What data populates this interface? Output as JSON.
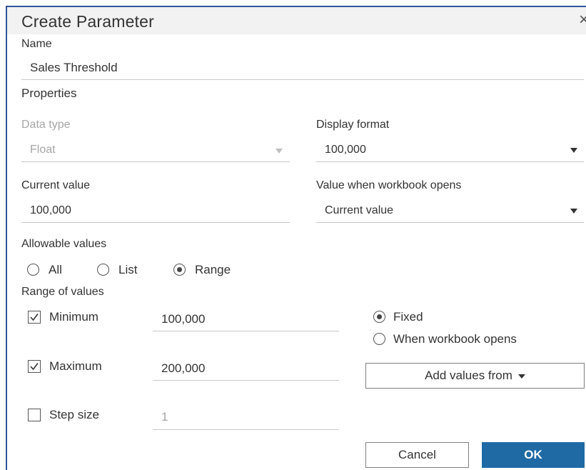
{
  "dialog": {
    "title": "Create Parameter",
    "close_symbol": "×"
  },
  "name": {
    "label": "Name",
    "value": "Sales Threshold"
  },
  "properties": {
    "label": "Properties",
    "data_type": {
      "label": "Data type",
      "value": "Float"
    },
    "display_format": {
      "label": "Display format",
      "value": "100,000"
    },
    "current_value": {
      "label": "Current value",
      "value": "100,000"
    },
    "value_when_opens": {
      "label": "Value when workbook opens",
      "value": "Current value"
    }
  },
  "allowable_values": {
    "label": "Allowable values",
    "options": [
      {
        "label": "All",
        "selected": false
      },
      {
        "label": "List",
        "selected": false
      },
      {
        "label": "Range",
        "selected": true
      }
    ]
  },
  "range": {
    "label": "Range of values",
    "minimum": {
      "label": "Minimum",
      "checked": true,
      "value": "100,000"
    },
    "maximum": {
      "label": "Maximum",
      "checked": true,
      "value": "200,000"
    },
    "step_size": {
      "label": "Step size",
      "checked": false,
      "value": "1"
    },
    "fixed_label": "Fixed",
    "when_opens_label": "When workbook opens",
    "add_values_from": "Add values from"
  },
  "buttons": {
    "cancel": "Cancel",
    "ok": "OK"
  },
  "icons": {
    "close": "close-icon",
    "dropdown": "chevron-down-icon",
    "check": "check-icon"
  },
  "colors": {
    "frame": "#2f5597",
    "primary": "#1f6aa5",
    "muted_text": "#a6a6a6"
  }
}
